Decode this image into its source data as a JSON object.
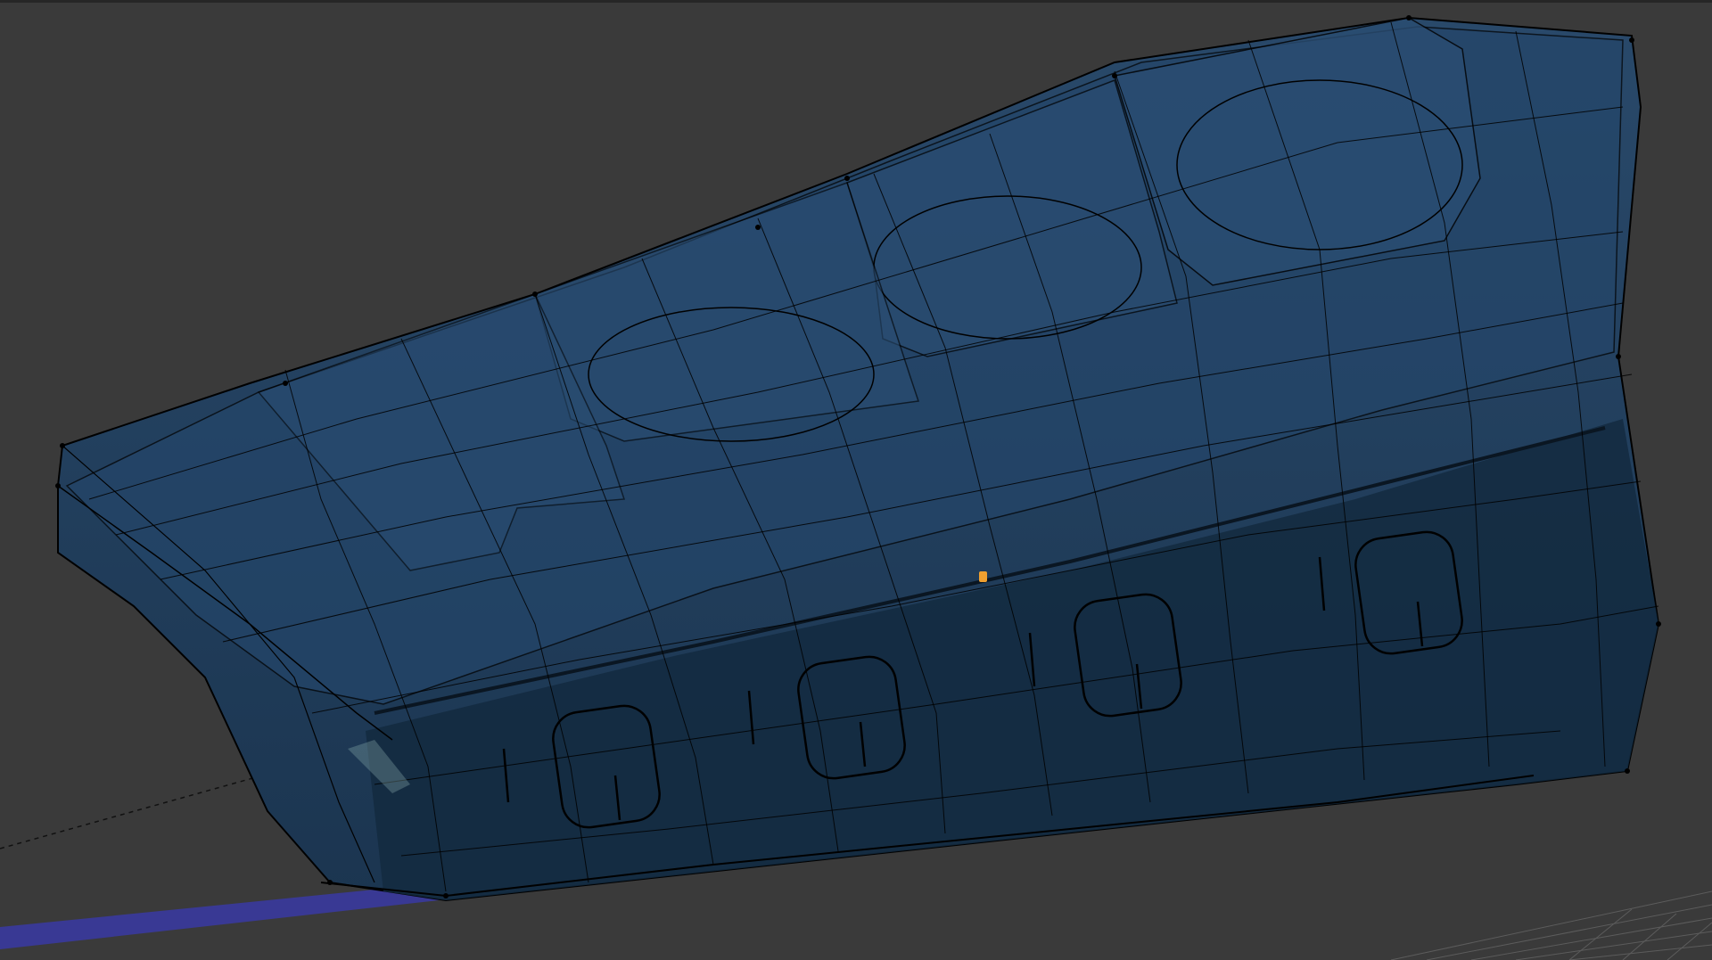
{
  "viewport": {
    "background_color": "#3a3a3a",
    "mesh_face_color": "#1f3a55",
    "mesh_face_dark_color": "#14283b",
    "mesh_edge_color": "#000000",
    "selected_vertex_color": "#f0a030",
    "axis_line_color": "#3b3aa0",
    "grid_color": "#5a5a5a"
  }
}
